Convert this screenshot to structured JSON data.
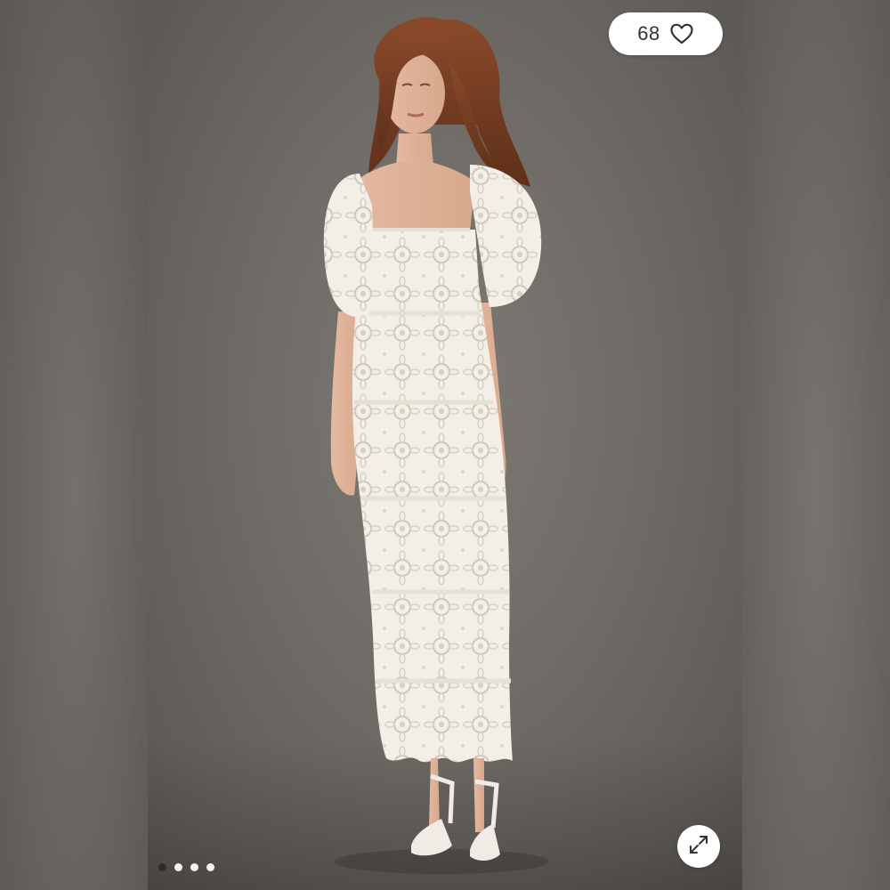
{
  "gallery": {
    "likes": {
      "count": "68",
      "icon": "heart-icon"
    },
    "expand": {
      "icon": "expand-arrows-icon"
    },
    "pagination": {
      "total": 4,
      "active_index": 0
    },
    "photo": {
      "subject": "model-in-white-lace-midi-dress"
    }
  },
  "colors": {
    "background": "#6e6b66",
    "dress": "#f3efe6",
    "button_bg": "#ffffff",
    "active_dot": "#2d2d2d"
  }
}
